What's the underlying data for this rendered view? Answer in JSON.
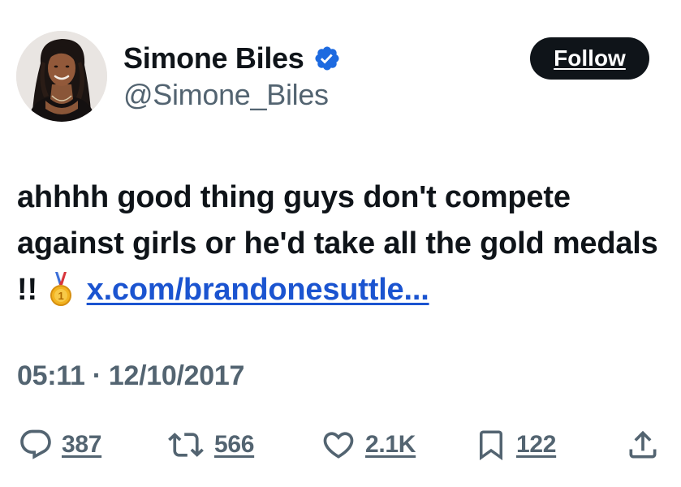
{
  "author": {
    "display_name": "Simone Biles",
    "handle": "@Simone_Biles",
    "verified": true
  },
  "follow_button": {
    "label": "Follow"
  },
  "tweet": {
    "text_main": "ahhhh good thing guys don't compete against girls or he'd take all the gold medals !!",
    "link_text": "x.com/brandonesuttle..."
  },
  "timestamp": "05:11 · 12/10/2017",
  "actions": {
    "replies": "387",
    "reposts": "566",
    "likes": "2.1K",
    "bookmarks": "122"
  },
  "colors": {
    "text_primary": "#0f1419",
    "text_secondary": "#536471",
    "link": "#1b54d0",
    "verified_badge": "#1d9bf0",
    "follow_bg": "#0f1419"
  },
  "icons": {
    "verified": "verified-badge-icon",
    "medal": "1st-place-medal-icon",
    "reply": "reply-icon",
    "repost": "repost-icon",
    "like": "heart-icon",
    "bookmark": "bookmark-icon",
    "share": "share-icon"
  }
}
